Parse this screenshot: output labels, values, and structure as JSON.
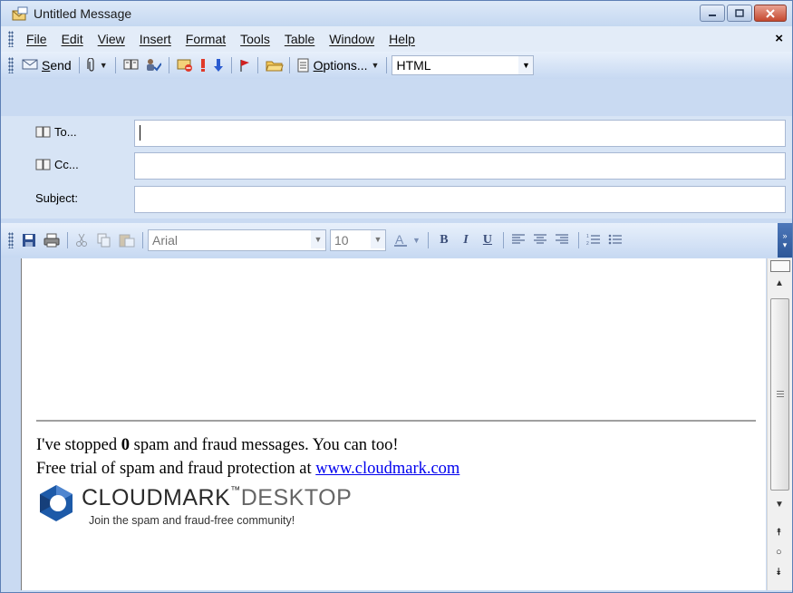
{
  "window": {
    "title": "Untitled Message"
  },
  "menu": {
    "items": [
      "File",
      "Edit",
      "View",
      "Insert",
      "Format",
      "Tools",
      "Table",
      "Window",
      "Help"
    ],
    "close": "×"
  },
  "toolbar": {
    "send_label": "Send",
    "options_label": "Options...",
    "format_value": "HTML"
  },
  "headers": {
    "to_label": "To...",
    "cc_label": "Cc...",
    "subject_label": "Subject:",
    "to_value": "",
    "cc_value": "",
    "subject_value": ""
  },
  "format_toolbar": {
    "font_value": "Arial",
    "size_value": "10",
    "bold": "B",
    "italic": "I",
    "underline": "U"
  },
  "body": {
    "line1_prefix": "I've stopped ",
    "line1_count": "0",
    "line1_suffix": " spam and fraud messages. You can too!",
    "line2_prefix": "Free trial of spam and fraud protection at ",
    "line2_link": "www.cloudmark.com",
    "logo_brand": "CLOUDMARK",
    "logo_product": "DESKTOP",
    "logo_tm": "™",
    "logo_tagline": "Join the spam and fraud-free community!"
  },
  "colors": {
    "window_frame": "#c9daf2",
    "link": "#0000ee",
    "logo_blue": "#1d5aa8"
  }
}
